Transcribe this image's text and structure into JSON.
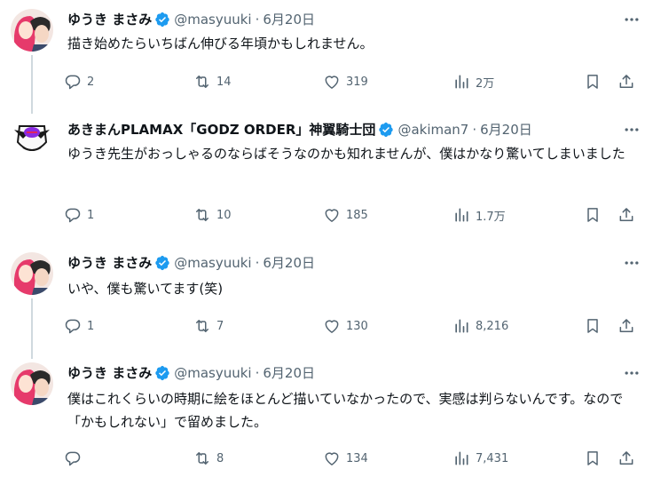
{
  "colors": {
    "text": "#0f1419",
    "muted": "#536471",
    "verified": "#1d9bf0",
    "border": "#eff3f4",
    "thread_line": "#cfd9de"
  },
  "tweets": [
    {
      "name": "ゆうき まさみ",
      "handle": "@masyuuki",
      "separator": "·",
      "date": "6月20日",
      "text": "描き始めたらいちばん伸びる年頃かもしれません。",
      "replies": "2",
      "retweets": "14",
      "likes": "319",
      "views": "2万"
    },
    {
      "name": "あきまんPLAMAX「GODZ ORDER」神翼騎士団",
      "handle": "@akiman7",
      "separator": "·",
      "date": "6月20日",
      "text": "ゆうき先生がおっしゃるのならばそうなのかも知れませんが、僕はかなり驚いてしまいました",
      "replies": "1",
      "retweets": "10",
      "likes": "185",
      "views": "1.7万"
    },
    {
      "name": "ゆうき まさみ",
      "handle": "@masyuuki",
      "separator": "·",
      "date": "6月20日",
      "text": "いや、僕も驚いてます(笑)",
      "replies": "1",
      "retweets": "7",
      "likes": "130",
      "views": "8,216"
    },
    {
      "name": "ゆうき まさみ",
      "handle": "@masyuuki",
      "separator": "·",
      "date": "6月20日",
      "text": "僕はこれくらいの時期に絵をほとんど描いていなかったので、実感は判らないんです。なので「かもしれない」で留めました。",
      "replies": "",
      "retweets": "8",
      "likes": "134",
      "views": "7,431"
    }
  ]
}
